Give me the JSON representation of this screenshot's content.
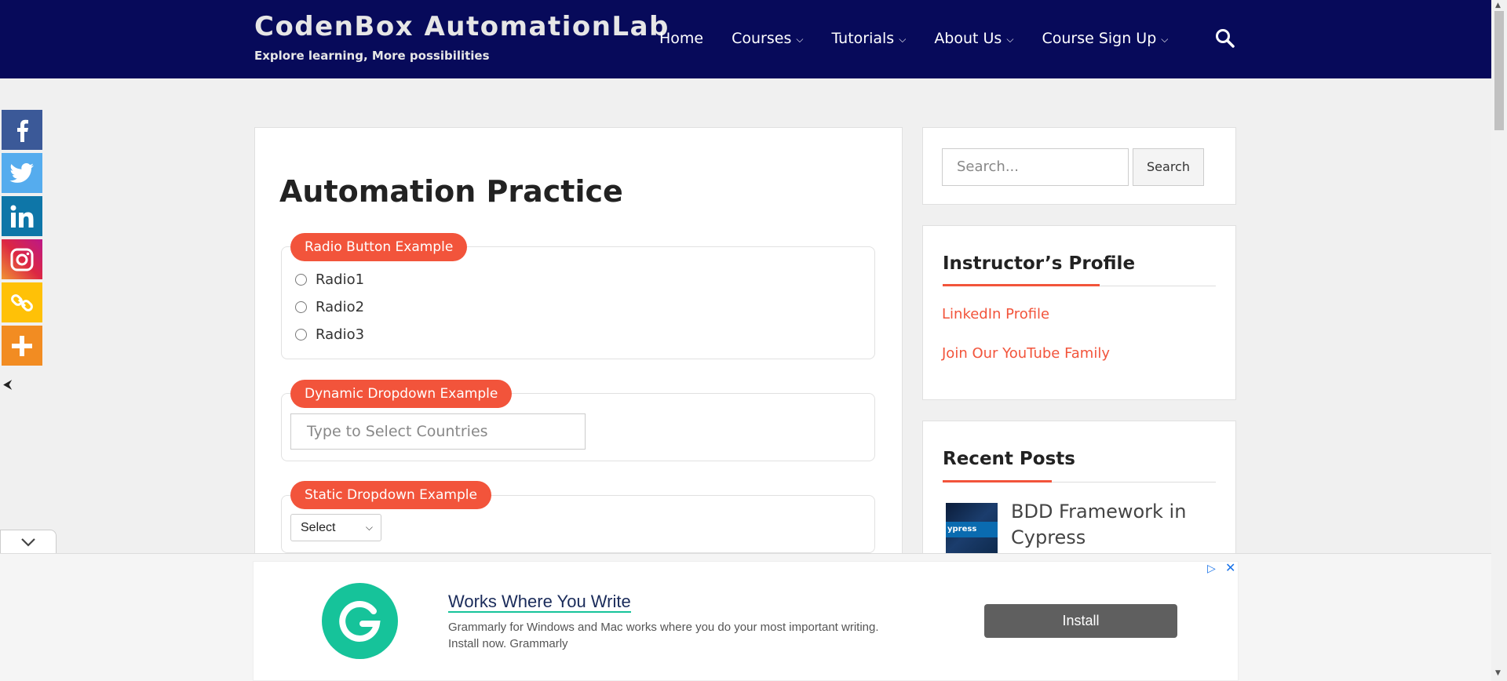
{
  "header": {
    "brand_title": "CodenBox AutomationLab",
    "brand_tagline": "Explore learning, More possibilities",
    "nav": [
      {
        "label": "Home",
        "has_dropdown": false
      },
      {
        "label": "Courses",
        "has_dropdown": true
      },
      {
        "label": "Tutorials",
        "has_dropdown": true
      },
      {
        "label": "About Us",
        "has_dropdown": true
      },
      {
        "label": "Course Sign Up",
        "has_dropdown": true
      }
    ],
    "search_icon": "search-icon",
    "background_color": "#070a5a"
  },
  "social": {
    "items": [
      {
        "name": "facebook-icon",
        "color": "#3b5998"
      },
      {
        "name": "twitter-icon",
        "color": "#55acee"
      },
      {
        "name": "linkedin-icon",
        "color": "#0e76a8"
      },
      {
        "name": "instagram-icon",
        "color": "#c13584"
      },
      {
        "name": "copy-link-icon",
        "color": "#ffc107"
      },
      {
        "name": "more-icon",
        "color": "#f28c22"
      }
    ],
    "hide_icon": "hide-arrow-icon"
  },
  "main": {
    "title": "Automation Practice",
    "radio_section": {
      "legend": "Radio Button Example",
      "options": [
        "Radio1",
        "Radio2",
        "Radio3"
      ]
    },
    "dynamic_dropdown": {
      "legend": "Dynamic Dropdown Example",
      "placeholder": "Type to Select Countries"
    },
    "static_dropdown": {
      "legend": "Static Dropdown Example",
      "selected": "Select"
    }
  },
  "sidebar": {
    "search": {
      "placeholder": "Search...",
      "button": "Search"
    },
    "profile": {
      "title": "Instructor’s Profile",
      "links": [
        "LinkedIn Profile",
        "Join Our YouTube Family"
      ]
    },
    "recent_posts": {
      "title": "Recent Posts",
      "posts": [
        {
          "title": "BDD Framework in Cypress",
          "thumb_text": "ypress"
        }
      ]
    }
  },
  "ad": {
    "headline": "Works Where You Write",
    "body": "Grammarly for Windows and Mac works where you do your most important writing. Install now. Grammarly",
    "button": "Install",
    "logo_icon": "grammarly-logo-icon",
    "accent_color": "#16c39a"
  },
  "accent_color": "#f2543b"
}
